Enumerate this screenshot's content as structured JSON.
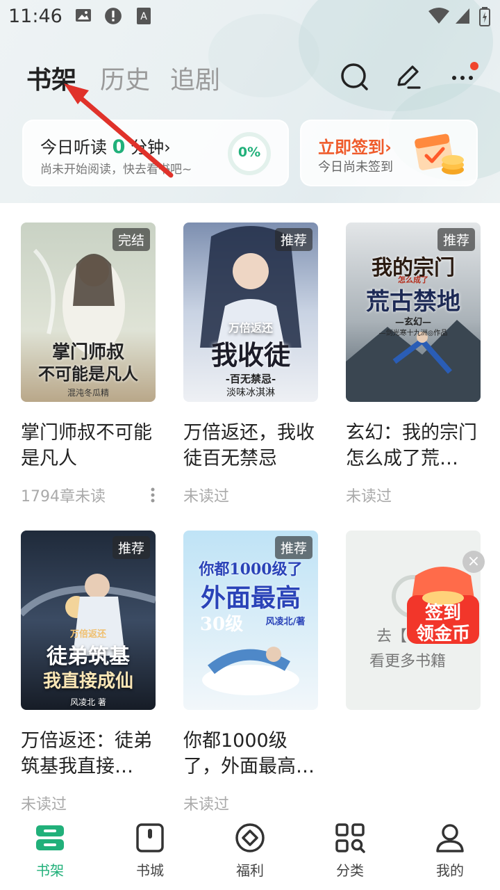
{
  "status_bar": {
    "time": "11:46"
  },
  "header": {
    "tabs": [
      {
        "label": "书架",
        "active": true
      },
      {
        "label": "历史",
        "active": false
      },
      {
        "label": "追剧",
        "active": false
      }
    ],
    "icons": [
      "search-icon",
      "edit-icon",
      "more-icon"
    ]
  },
  "reading_card": {
    "title_prefix": "今日听读",
    "minutes": "0",
    "title_suffix": "分钟",
    "chevron": "›",
    "subtitle": "尚未开始阅读，快去看书吧~",
    "progress": "0%"
  },
  "signin_card": {
    "title": "立即签到",
    "chevron": "›",
    "subtitle": "今日尚未签到"
  },
  "books": [
    {
      "title": "掌门师叔不可能是凡人",
      "badge": "完结",
      "sub": "1794章未读",
      "cover_lines": [
        "掌门师叔",
        "不可能是凡人"
      ],
      "cover_author": "混沌冬瓜精"
    },
    {
      "title": "万倍返还，我收徒百无禁忌",
      "badge": "推荐",
      "sub": "未读过",
      "cover_lines": [
        "万倍返还",
        "我收徒"
      ],
      "cover_tag": "-百无禁忌-",
      "cover_author": "淡味冰淇淋"
    },
    {
      "title": "玄幻：我的宗门怎么成了荒…",
      "badge": "推荐",
      "sub": "未读过",
      "cover_lines": [
        "我的宗门",
        "荒古禁地"
      ],
      "cover_small": "怎么成了",
      "cover_tag": "—玄幻—",
      "cover_author": "—剑光寒十九洲◎作品"
    },
    {
      "title": "万倍返还：徒弟筑基我直接…",
      "badge": "推荐",
      "sub": "未读过",
      "cover_lines": [
        "万倍返还",
        "徒弟筑基",
        "我直接成仙"
      ],
      "cover_author": "风凌北 著"
    },
    {
      "title": "你都1000级了，外面最高…",
      "badge": "推荐",
      "sub": "未读过",
      "cover_lines": [
        "你都1000级了",
        "外面最高",
        "30级"
      ],
      "cover_author": "风凌北/著"
    }
  ],
  "promo": {
    "line1": "去【",
    "line2": "看更多书籍",
    "close": "×",
    "redpack_line1": "签到",
    "redpack_line2": "领金币"
  },
  "bottom_nav": [
    {
      "label": "书架",
      "icon": "bookshelf-icon",
      "active": true
    },
    {
      "label": "书城",
      "icon": "bookstore-icon",
      "active": false
    },
    {
      "label": "福利",
      "icon": "welfare-icon",
      "active": false
    },
    {
      "label": "分类",
      "icon": "category-icon",
      "active": false
    },
    {
      "label": "我的",
      "icon": "profile-icon",
      "active": false
    }
  ],
  "colors": {
    "accent": "#21b07a",
    "signin": "#ef5b2b",
    "annotation_arrow": "#e0322a"
  }
}
